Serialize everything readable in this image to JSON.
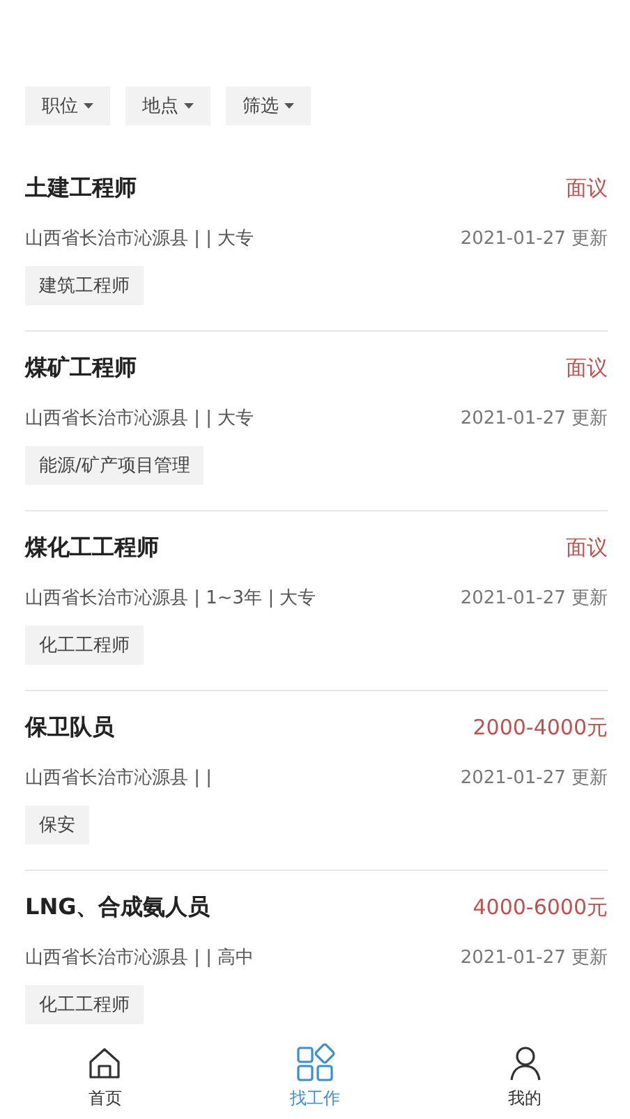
{
  "filters": [
    {
      "label": "职位"
    },
    {
      "label": "地点"
    },
    {
      "label": "筛选"
    }
  ],
  "jobs": [
    {
      "title": "土建工程师",
      "salary": "面议",
      "location": "山西省长治市沁源县 | | 大专",
      "updated": "2021-01-27 更新",
      "tag": "建筑工程师"
    },
    {
      "title": "煤矿工程师",
      "salary": "面议",
      "location": "山西省长治市沁源县 | | 大专",
      "updated": "2021-01-27 更新",
      "tag": "能源/矿产项目管理"
    },
    {
      "title": "煤化工工程师",
      "salary": "面议",
      "location": "山西省长治市沁源县 | 1~3年 | 大专",
      "updated": "2021-01-27 更新",
      "tag": "化工工程师"
    },
    {
      "title": "保卫队员",
      "salary": "2000-4000元",
      "location": "山西省长治市沁源县 | |",
      "updated": "2021-01-27 更新",
      "tag": "保安"
    },
    {
      "title": "LNG、合成氨人员",
      "salary": "4000-6000元",
      "location": "山西省长治市沁源县 | | 高中",
      "updated": "2021-01-27 更新",
      "tag": "化工工程师"
    }
  ],
  "nav": [
    {
      "kind": "home",
      "label": "首页",
      "selected": false
    },
    {
      "kind": "apps",
      "label": "找工作",
      "selected": true
    },
    {
      "kind": "person",
      "label": "我的",
      "selected": false
    }
  ]
}
